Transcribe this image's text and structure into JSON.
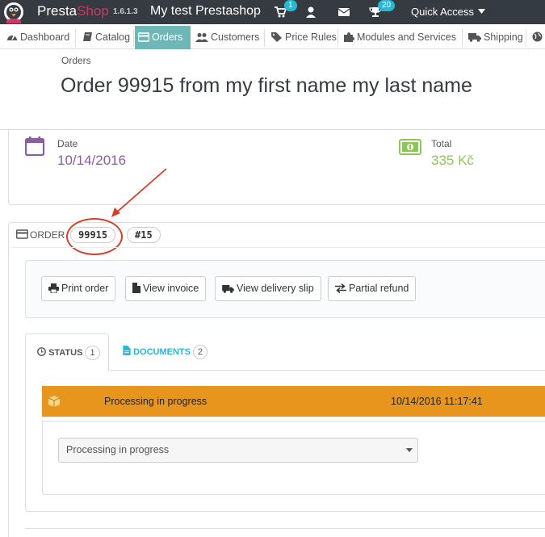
{
  "topbar": {
    "brand_a": "Presta",
    "brand_b": "Shop",
    "version": "1.6.1.3",
    "shop_name": "My test Prestashop",
    "cart_badge": "1",
    "trophy_badge": "20",
    "quick_access": "Quick Access"
  },
  "menu": [
    {
      "label": "Dashboard",
      "icon": "tachometer-icon"
    },
    {
      "label": "Catalog",
      "icon": "book-icon"
    },
    {
      "label": "Orders",
      "icon": "credit-card-icon",
      "active": true
    },
    {
      "label": "Customers",
      "icon": "users-icon"
    },
    {
      "label": "Price Rules",
      "icon": "tags-icon"
    },
    {
      "label": "Modules and Services",
      "icon": "puzzle-icon"
    },
    {
      "label": "Shipping",
      "icon": "truck-icon"
    }
  ],
  "breadcrumb": "Orders",
  "page_title": "Order 99915 from my first name my last name",
  "kpi": {
    "date_label": "Date",
    "date_value": "10/14/2016",
    "total_label": "Total",
    "total_value": "335 Kč"
  },
  "order_panel": {
    "heading": "ORDER",
    "reference": "99915",
    "id": "#15"
  },
  "actions": {
    "print": "Print order",
    "invoice": "View invoice",
    "delivery": "View delivery slip",
    "refund": "Partial refund"
  },
  "tabs": {
    "status_label": "STATUS",
    "status_count": "1",
    "documents_label": "DOCUMENTS",
    "documents_count": "2"
  },
  "status_history": {
    "state": "Processing in progress",
    "date": "10/14/2016 11:17:41"
  },
  "status_select": {
    "selected": "Processing in progress"
  },
  "colors": {
    "topbar": "#363a41",
    "brand_pink": "#c8396a",
    "active_tab": "#6fb7b7",
    "date_purple": "#8e5ba2",
    "total_green": "#8bc954",
    "status_orange": "#e8951e",
    "badge_blue": "#25b9d7",
    "annotation_red": "#d3402a"
  }
}
